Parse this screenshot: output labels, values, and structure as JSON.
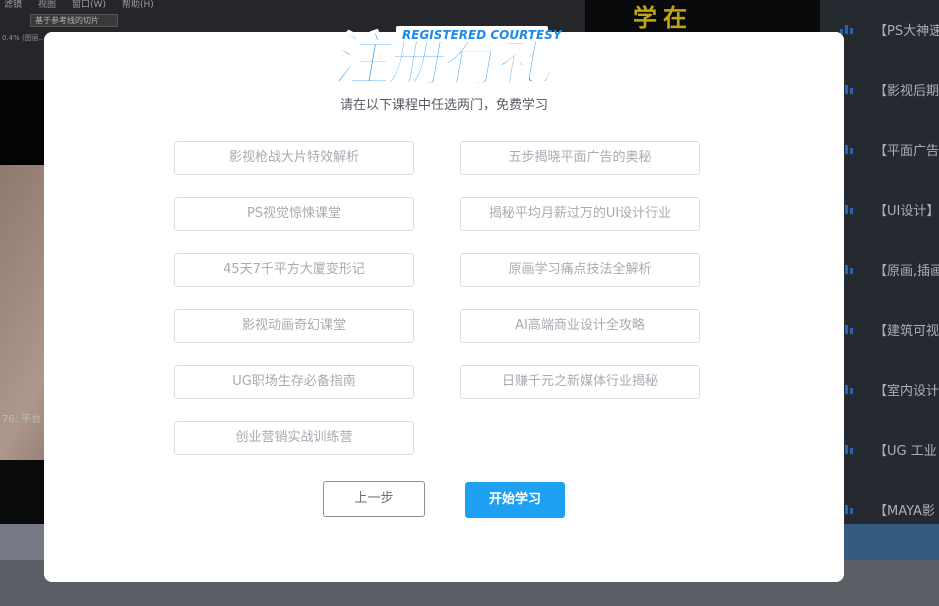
{
  "background": {
    "toolbar_menu": [
      "滤镜",
      "视图",
      "窗口(W)",
      "帮助(H)"
    ],
    "toolbar_field": "基于参考线的切片",
    "toolbar_dim_label": "0.4% (图层...",
    "photo_caption": "76: 平台",
    "banner_text": "学在",
    "sidebar_courses": [
      "【PS大神速",
      "【影视后期",
      "【平面广告",
      "【UI设计】",
      "【原画,插画",
      "【建筑可视",
      "【室内设计",
      "【UG 工业",
      "【MAYA影"
    ]
  },
  "modal": {
    "logo_text": "注册有礼",
    "logo_subtext": "REGISTERED COURTESY",
    "subtitle": "请在以下课程中任选两门，免费学习",
    "options": [
      "影视枪战大片特效解析",
      "五步揭晓平面广告的奥秘",
      "PS视觉惊悚课堂",
      "揭秘平均月薪过万的UI设计行业",
      "45天7千平方大厦变形记",
      "原画学习痛点技法全解析",
      "影视动画奇幻课堂",
      "AI高端商业设计全攻略",
      "UG职场生存必备指南",
      "日赚千元之新媒体行业揭秘",
      "创业营销实战训练营"
    ],
    "prev_button": "上一步",
    "start_button": "开始学习"
  },
  "colors": {
    "accent": "#1ea1f2",
    "logo_blue": "#1e8be8",
    "option_border": "#dcdee3",
    "option_text": "#a8abb2"
  }
}
